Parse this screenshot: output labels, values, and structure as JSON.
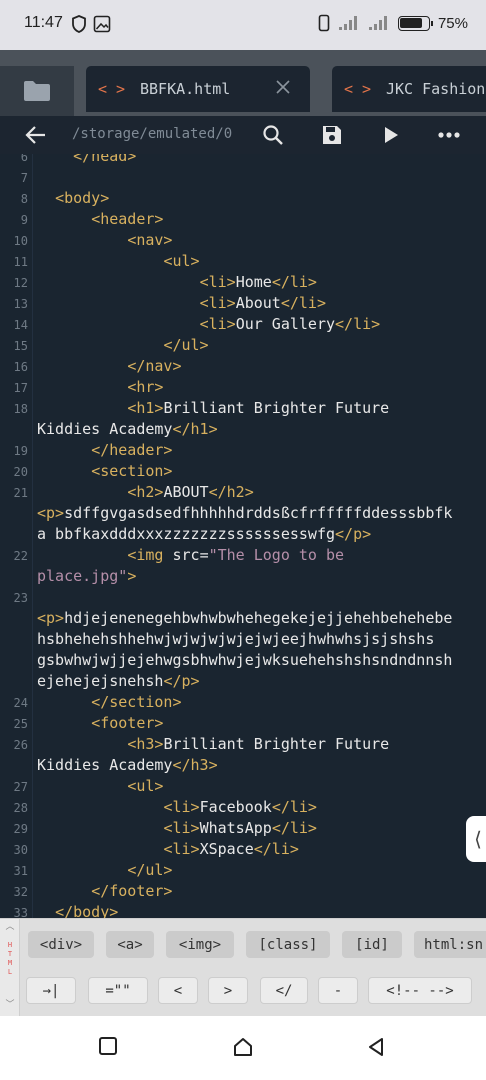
{
  "status": {
    "time": "11:47",
    "battery": "75%"
  },
  "tabs": [
    {
      "label": "BBFKA.html",
      "icon": "code-icon"
    },
    {
      "label": "JKC Fashion",
      "icon": "code-icon"
    }
  ],
  "code_icon": "< >",
  "toolbar": {
    "path": "/storage/emulated/0"
  },
  "gutter": [
    "6",
    "7",
    "8",
    "9",
    "10",
    "11",
    "12",
    "13",
    "14",
    "15",
    "16",
    "17",
    "18",
    "",
    "19",
    "20",
    "21",
    "",
    "",
    "22",
    "",
    "23",
    "",
    "",
    "",
    "",
    "24",
    "25",
    "26",
    "",
    "27",
    "28",
    "29",
    "30",
    "31",
    "32",
    "33"
  ],
  "code": {
    "l6": {
      "t1": "</head>"
    },
    "l8": {
      "t1": "<body>"
    },
    "l9": {
      "t1": "<header>"
    },
    "l10": {
      "t1": "<nav>"
    },
    "l11": {
      "t1": "<ul>"
    },
    "l12": {
      "t1": "<li>",
      "x": "Home",
      "t2": "</li>"
    },
    "l13": {
      "t1": "<li>",
      "x": "About",
      "t2": "</li>"
    },
    "l14": {
      "t1": "<li>",
      "x": "Our Gallery",
      "t2": "</li>"
    },
    "l15": {
      "t1": "</ul>"
    },
    "l16": {
      "t1": "</nav>"
    },
    "l17": {
      "t1": "<hr>"
    },
    "l18a": {
      "t1": "<h1>",
      "x": "Brilliant Brighter Future"
    },
    "l18b": {
      "x": "Kiddies Academy",
      "t2": "</h1>"
    },
    "l19": {
      "t1": "</header>"
    },
    "l20": {
      "t1": "<section>"
    },
    "l21a": {
      "t1": "<h2>",
      "x": "ABOUT",
      "t2": "</h2>"
    },
    "l21b": {
      "t1": "<p>",
      "x": "sdffgvgasdsedfhhhhhdrddsßcfrfffffddesssbbfk"
    },
    "l21c": {
      "x": "a bbfkaxdddxxxzzzzzzzssssssesswfg",
      "t2": "</p>"
    },
    "l22a": {
      "t1": "<img ",
      "a": "src",
      "e": "=",
      "s": "\"The Logo to be"
    },
    "l22b": {
      "s": "place.jpg\"",
      "t2": ">"
    },
    "l23b": {
      "t1": "<p>",
      "x": "hdjejenenegehbwhwbwhehegekejejjehehbehehebe"
    },
    "l23c": {
      "x": "hsbhehehshhehwjwjwjwjwjejwjeejhwhwhsjsjshshs"
    },
    "l23d": {
      "x": "gsbwhwjwjjejehwgsbhwhwjejwksuehehshshsndndnnsh"
    },
    "l23e": {
      "x": "ejehejejsnehsh",
      "t2": "</p>"
    },
    "l24": {
      "t1": "</section>"
    },
    "l25": {
      "t1": "<footer>"
    },
    "l26a": {
      "t1": "<h3>",
      "x": "Brilliant Brighter Future"
    },
    "l26b": {
      "x": "Kiddies Academy",
      "t2": "</h3>"
    },
    "l27": {
      "t1": "<ul>"
    },
    "l28": {
      "t1": "<li>",
      "x": "Facebook",
      "t2": "</li>"
    },
    "l29": {
      "t1": "<li>",
      "x": "WhatsApp",
      "t2": "</li>"
    },
    "l30": {
      "t1": "<li>",
      "x": "XSpace",
      "t2": "</li>"
    },
    "l31": {
      "t1": "</ul>"
    },
    "l32": {
      "t1": "</footer>"
    },
    "l33": {
      "t1": "</body>"
    }
  },
  "snippets": {
    "side_label": "HTML",
    "row1": [
      "<div>",
      "<a>",
      "<img>",
      "[class]",
      "[id]",
      "html:sn"
    ],
    "row2": [
      "→|",
      "=\"\"",
      "<",
      ">",
      "</",
      "-",
      "<!-- -->"
    ]
  },
  "colors": {
    "tag": "#d8b15f",
    "string": "#b58fa9",
    "text": "#e8e8e8",
    "accent": "#e2744a",
    "editor_bg": "#1a2530"
  }
}
